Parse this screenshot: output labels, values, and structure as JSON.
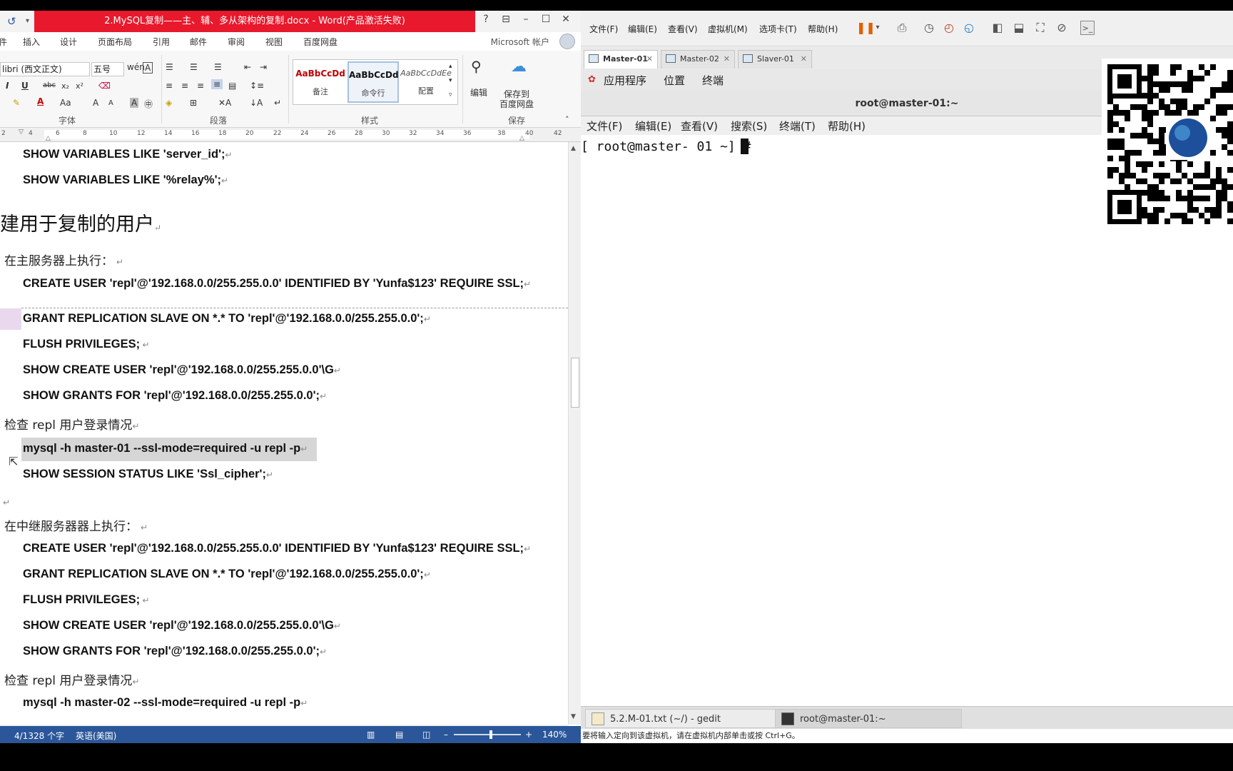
{
  "word": {
    "title": "2.MySQL复制——主、辅、多从架构的复制.docx - Word(产品激活失败)",
    "help": "?",
    "ribbon_tabs": [
      "插入",
      "设计",
      "页面布局",
      "引用",
      "邮件",
      "审阅",
      "视图",
      "百度网盘"
    ],
    "account": "Microsoft 帐户",
    "font_name": "libri (西文正文)",
    "font_size": "五号",
    "group_labels": {
      "font": "字体",
      "paragraph": "段落",
      "styles": "样式",
      "save": "保存"
    },
    "styles": [
      {
        "sample": "AaBbCcDd",
        "name": "备注"
      },
      {
        "sample": "AaBbCcDd",
        "name": "命令行"
      },
      {
        "sample": "AaBbCcDdEe",
        "name": "配置"
      }
    ],
    "edit_label": "编辑",
    "save_label_1": "保存到",
    "save_label_2": "百度网盘",
    "ruler_numbers": [
      "2",
      "4",
      "6",
      "8",
      "10",
      "12",
      "14",
      "16",
      "18",
      "20",
      "22",
      "24",
      "26",
      "28",
      "30",
      "32",
      "34",
      "36",
      "38",
      "40",
      "42"
    ],
    "doc": {
      "l1": "SHOW VARIABLES LIKE 'server_id';",
      "l2": "SHOW VARIABLES LIKE '%relay%';",
      "heading": "建用于复制的用户",
      "s1": "在主服务器上执行：",
      "c1": "CREATE USER 'repl'@'192.168.0.0/255.255.0.0' IDENTIFIED BY 'Yunfa$123' REQUIRE SSL;",
      "c2": "GRANT REPLICATION SLAVE ON *.* TO 'repl'@'192.168.0.0/255.255.0.0';",
      "c3": "FLUSH PRIVILEGES;",
      "c4": "SHOW CREATE USER 'repl'@'192.168.0.0/255.255.0.0'\\G",
      "c5": "SHOW GRANTS FOR 'repl'@'192.168.0.0/255.255.0.0';",
      "s2": "检查 repl 用户登录情况",
      "c6": "mysql -h master-01 --ssl-mode=required -u repl -p",
      "c7": "SHOW SESSION STATUS LIKE 'Ssl_cipher';",
      "s3": "在中继服务器器上执行：",
      "d1": "CREATE USER 'repl'@'192.168.0.0/255.255.0.0' IDENTIFIED BY 'Yunfa$123' REQUIRE SSL;",
      "d2": "GRANT REPLICATION SLAVE ON *.* TO 'repl'@'192.168.0.0/255.255.0.0';",
      "d3": "FLUSH PRIVILEGES;",
      "d4": "SHOW CREATE USER 'repl'@'192.168.0.0/255.255.0.0'\\G",
      "d5": "SHOW GRANTS FOR 'repl'@'192.168.0.0/255.255.0.0';",
      "s4": "检查 repl 用户登录情况",
      "d6": "mysql -h master-02 --ssl-mode=required -u repl -p"
    },
    "status": {
      "words": "4/1328 个字",
      "lang": "英语(美国)",
      "zoom": "140%"
    }
  },
  "vm": {
    "menu": [
      "文件(F)",
      "编辑(E)",
      "查看(V)",
      "虚拟机(M)",
      "选项卡(T)",
      "帮助(H)"
    ],
    "tabs": [
      "Master-01",
      "Master-02",
      "Slaver-01"
    ],
    "gnome": [
      "应用程序",
      "位置",
      "终端"
    ],
    "terminal_title": "root@master-01:~",
    "terminal_menu": [
      "文件(F)",
      "编辑(E)",
      "查看(V)",
      "搜索(S)",
      "终端(T)",
      "帮助(H)"
    ],
    "prompt": "[ root@master- 01 ~] #",
    "taskbar": [
      "5.2.M-01.txt (~/) - gedit",
      "root@master-01:~"
    ],
    "status": "要将输入定向到该虚拟机，请在虚拟机内部单击或按 Ctrl+G。"
  }
}
